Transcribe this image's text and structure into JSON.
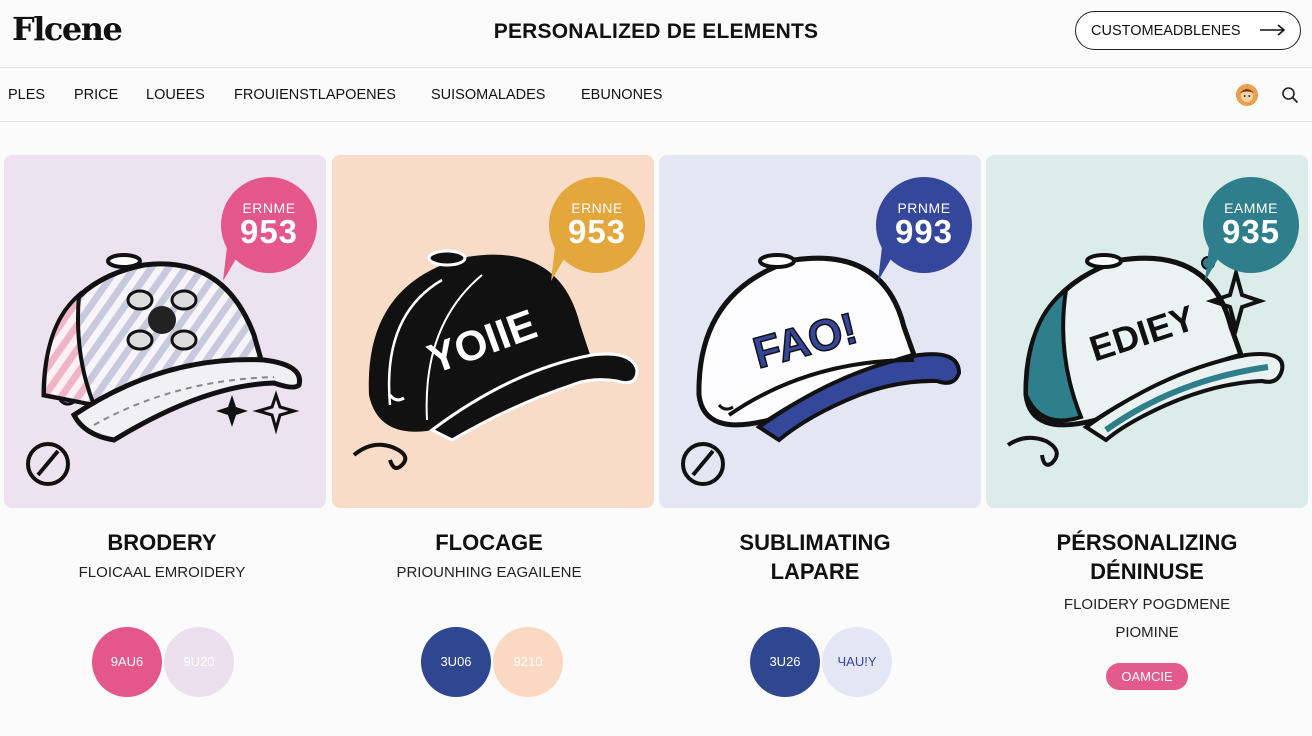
{
  "header": {
    "logo": "Flcene",
    "title": "PERSONALIZED DE ELEMENTS",
    "cta_label": "CUSTOMEADBLENES"
  },
  "nav": {
    "items": [
      "PLES",
      "PRICE",
      "LOUEES",
      "FROUIENSTLAPOENES",
      "SUISOMALADES",
      "EBUNONES"
    ]
  },
  "cards": [
    {
      "badge_top": "ERNME",
      "badge_num": "953",
      "badge_color": "#e4578a",
      "bg_color": "#ece2f0",
      "cap_text": "",
      "title_lines": [
        "BRODERY"
      ],
      "subtitle_lines": [
        "FLOICAAL EMROIDERY"
      ],
      "swatches": [
        {
          "label": "9AU6",
          "color": "#e4578a",
          "text_color": "#ffffff"
        },
        {
          "label": "9U20",
          "color": "#ece0ef",
          "text_color": "#ffffff"
        }
      ]
    },
    {
      "badge_top": "ERNNE",
      "badge_num": "953",
      "badge_color": "#e3a73c",
      "bg_color": "#f9dcc8",
      "cap_text": "YOIIE",
      "title_lines": [
        "FLOCAGE"
      ],
      "subtitle_lines": [
        "PRIOUNHING EAGAILENE"
      ],
      "swatches": [
        {
          "label": "3U06",
          "color": "#2f4690",
          "text_color": "#ffffff"
        },
        {
          "label": "9210",
          "color": "#fbd8c2",
          "text_color": "#ffffff"
        }
      ]
    },
    {
      "badge_top": "PRNME",
      "badge_num": "993",
      "badge_color": "#34479a",
      "bg_color": "#e4e6f3",
      "cap_text": "FAO!",
      "title_lines": [
        "SUBLIMATING",
        "LAPARE"
      ],
      "subtitle_lines": [],
      "swatches": [
        {
          "label": "3U26",
          "color": "#2f4690",
          "text_color": "#ffffff"
        },
        {
          "label": "ЧAU!Y",
          "color": "#e4e6f5",
          "text_color": "#34479a"
        }
      ]
    },
    {
      "badge_top": "EAMME",
      "badge_num": "935",
      "badge_color": "#2f7e8b",
      "bg_color": "#dcece9",
      "cap_text": "EDIEY",
      "title_lines": [
        "PÉRSONALIZING",
        "DÉNINUSE"
      ],
      "subtitle_lines": [
        "FLOIDERY POGDMENE",
        "PIOMINE"
      ],
      "button_label": "OAMCIE",
      "swatches": []
    }
  ]
}
